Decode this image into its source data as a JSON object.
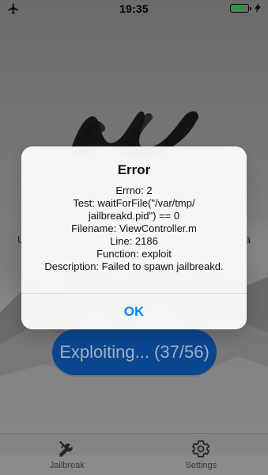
{
  "status_bar": {
    "time": "19:35"
  },
  "background": {
    "side_text_left": "U",
    "side_text_right": "a"
  },
  "main": {
    "action_button_label": "Exploiting... (37/56)"
  },
  "tabbar": {
    "tabs": [
      {
        "label": "Jailbreak",
        "icon": "tools-icon"
      },
      {
        "label": "Settings",
        "icon": "gear-icon"
      }
    ]
  },
  "alert": {
    "title": "Error",
    "lines": [
      "Errno: 2",
      "Test: waitForFile(\"/var/tmp/",
      "jailbreakd.pid\") == 0",
      "Filename: ViewController.m",
      "Line: 2186",
      "Function: exploit",
      "Description: Failed to spawn jailbreakd."
    ],
    "ok_label": "OK"
  },
  "colors": {
    "alert_button_blue": "#0a84ff",
    "action_button_blue": "#0f5fc0",
    "battery_green": "#38d15c"
  }
}
